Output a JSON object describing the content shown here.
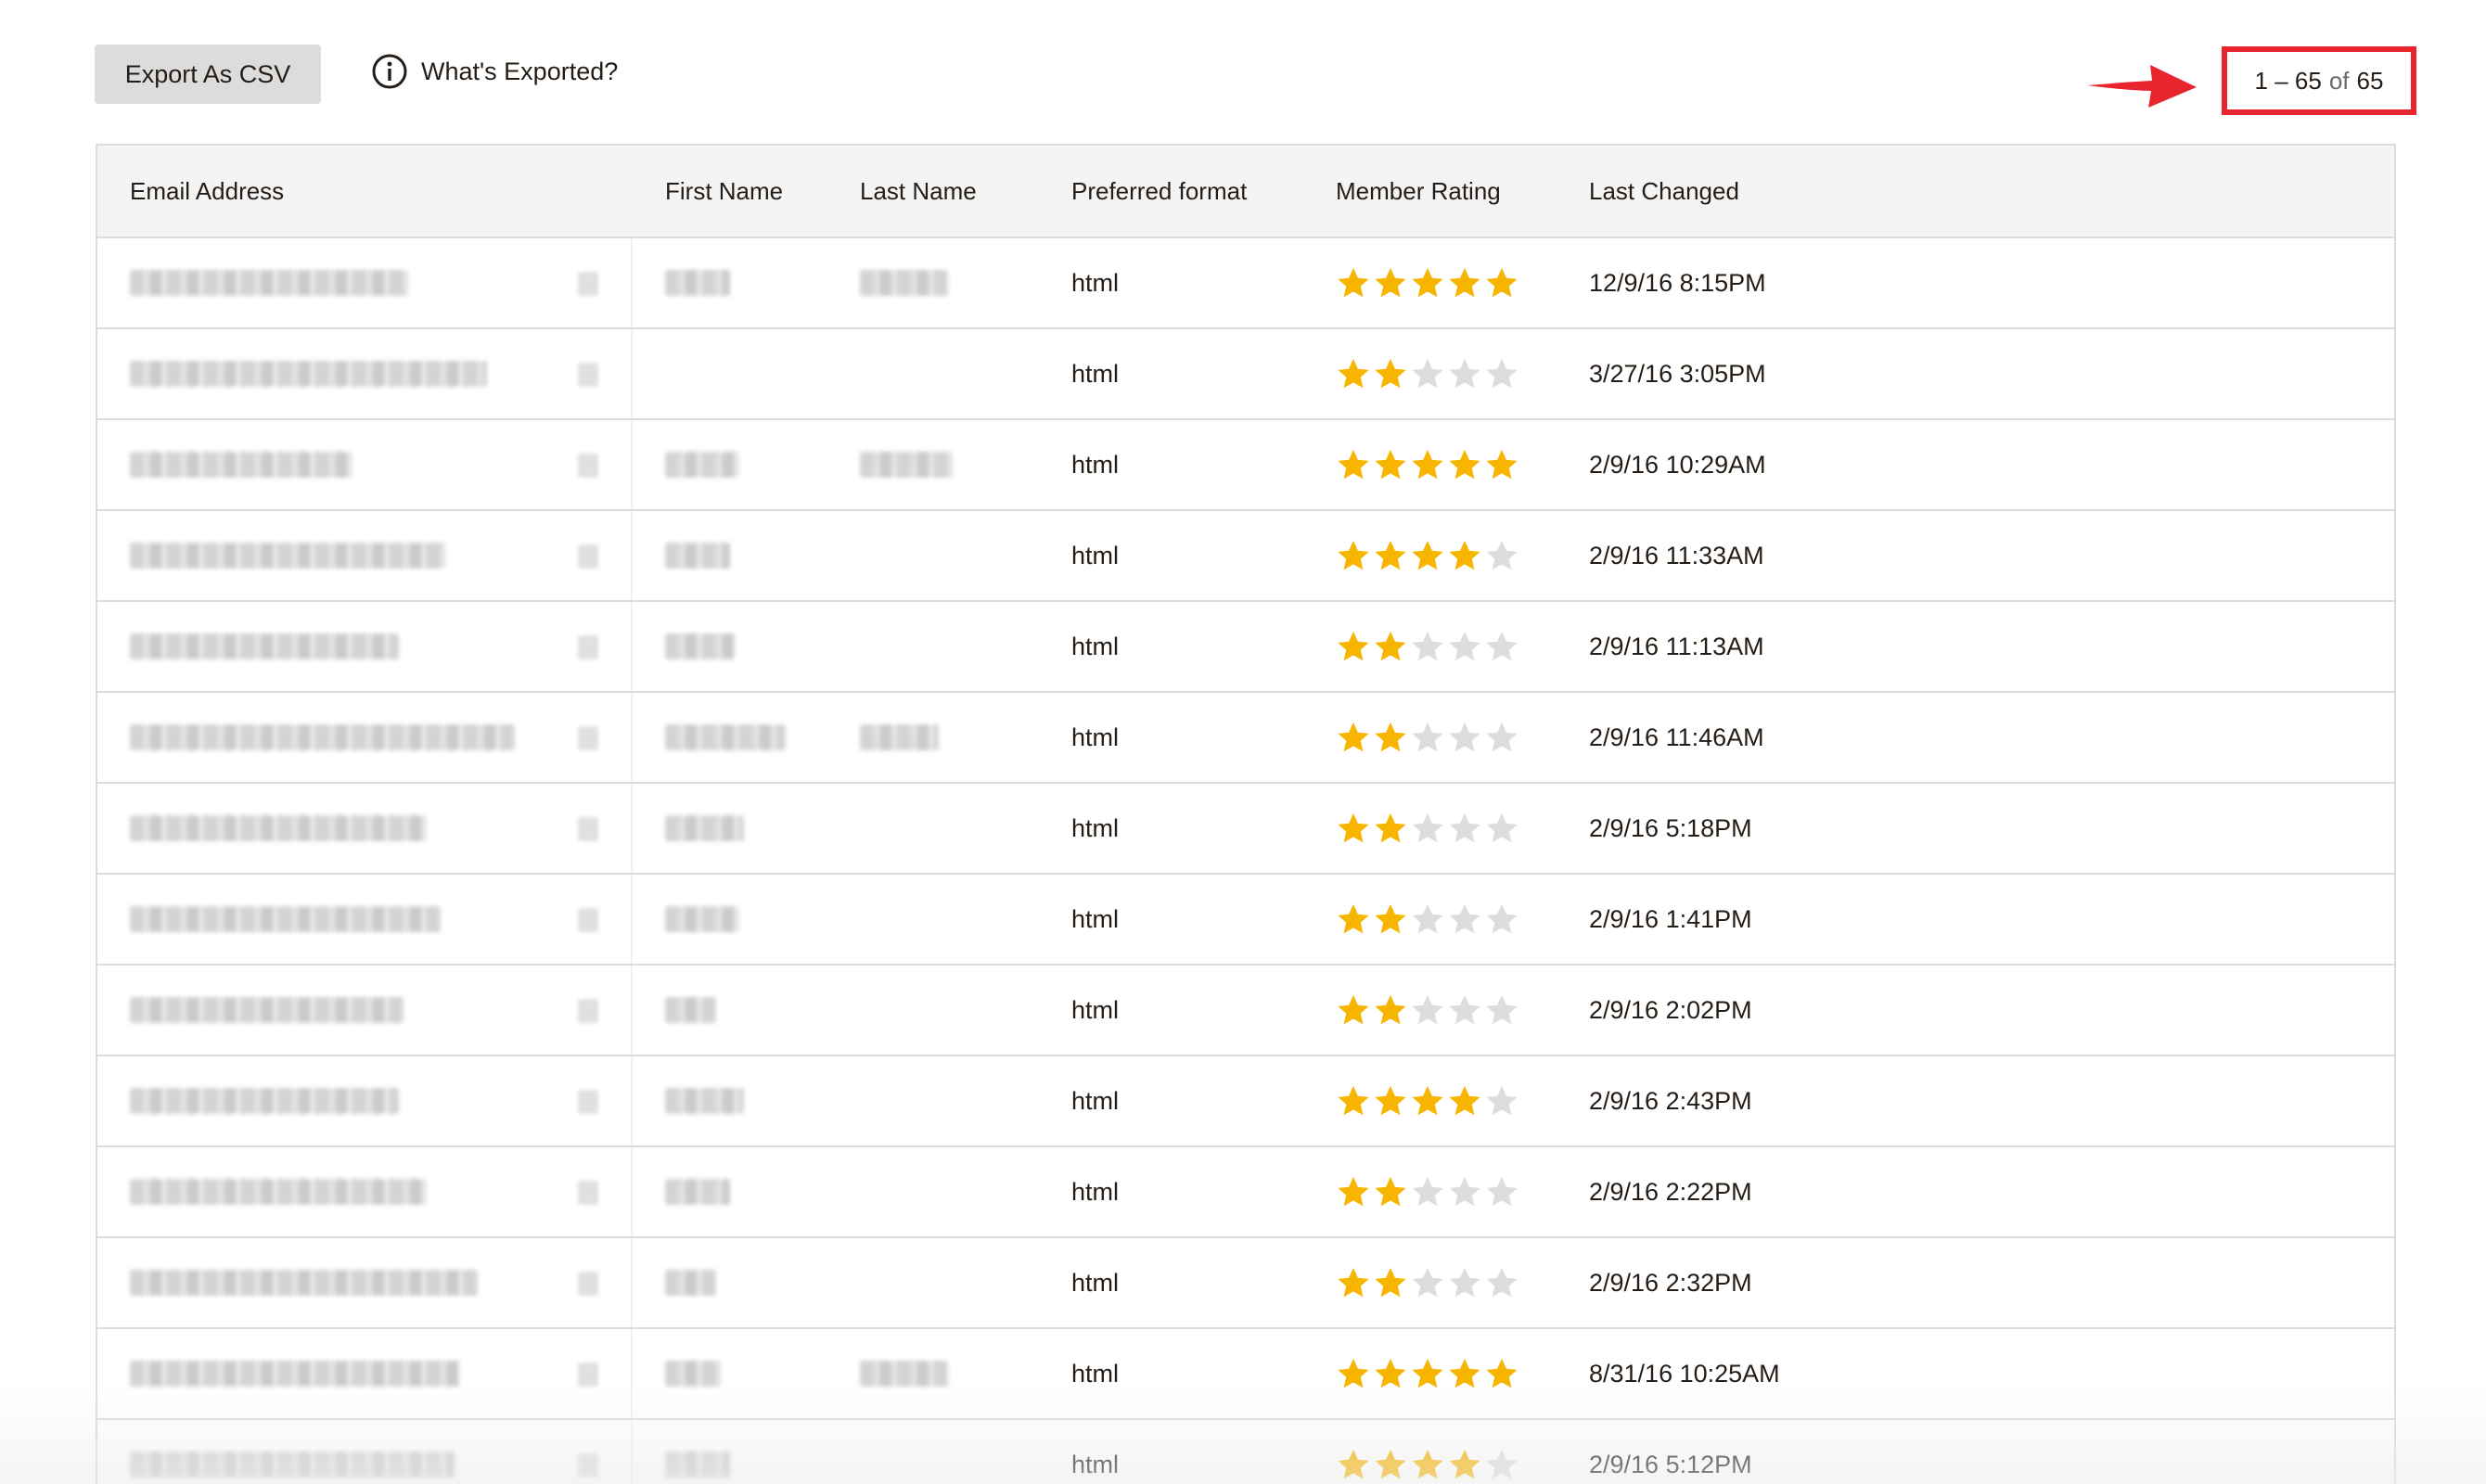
{
  "toolbar": {
    "export_label": "Export As CSV",
    "whats_exported_label": "What's Exported?",
    "info_icon": "info-circle-icon"
  },
  "pagination": {
    "range": "1 – 65",
    "of_label": "of",
    "total": "65"
  },
  "annotation": {
    "arrow_icon": "arrow-right-icon",
    "highlight_color": "#e8242f"
  },
  "table": {
    "columns": {
      "email": "Email Address",
      "first_name": "First Name",
      "last_name": "Last Name",
      "format": "Preferred format",
      "rating": "Member Rating",
      "changed": "Last Changed"
    },
    "rows": [
      {
        "format": "html",
        "rating": 5,
        "changed": "12/9/16 8:15PM"
      },
      {
        "format": "html",
        "rating": 2,
        "changed": "3/27/16 3:05PM"
      },
      {
        "format": "html",
        "rating": 5,
        "changed": "2/9/16 10:29AM"
      },
      {
        "format": "html",
        "rating": 4,
        "changed": "2/9/16 11:33AM"
      },
      {
        "format": "html",
        "rating": 2,
        "changed": "2/9/16 11:13AM"
      },
      {
        "format": "html",
        "rating": 2,
        "changed": "2/9/16 11:46AM"
      },
      {
        "format": "html",
        "rating": 2,
        "changed": "2/9/16 5:18PM"
      },
      {
        "format": "html",
        "rating": 2,
        "changed": "2/9/16 1:41PM"
      },
      {
        "format": "html",
        "rating": 2,
        "changed": "2/9/16 2:02PM"
      },
      {
        "format": "html",
        "rating": 4,
        "changed": "2/9/16 2:43PM"
      },
      {
        "format": "html",
        "rating": 2,
        "changed": "2/9/16 2:22PM"
      },
      {
        "format": "html",
        "rating": 2,
        "changed": "2/9/16 2:32PM"
      },
      {
        "format": "html",
        "rating": 5,
        "changed": "8/31/16 10:25AM"
      },
      {
        "format": "html",
        "rating": 4,
        "changed": "2/9/16 5:12PM"
      }
    ]
  },
  "colors": {
    "star_filled": "#f7b500",
    "star_empty": "#dddddd",
    "button_bg": "#dcdcdc",
    "border": "#dcdcdc"
  }
}
